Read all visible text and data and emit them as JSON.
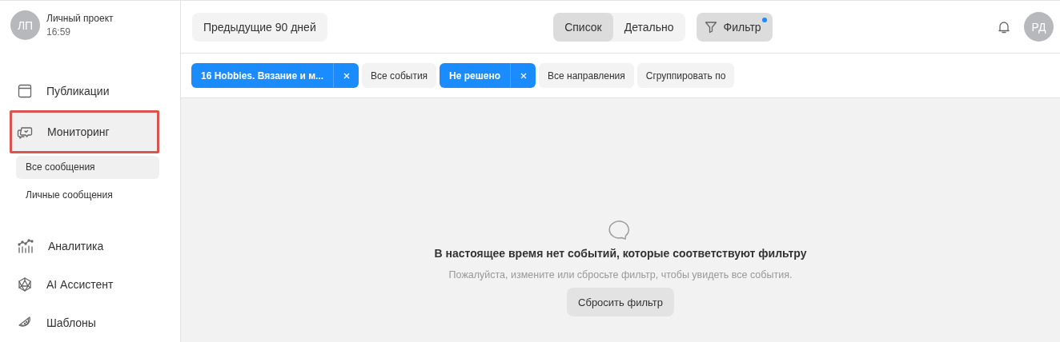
{
  "project": {
    "avatar": "ЛП",
    "name": "Личный проект",
    "time": "16:59"
  },
  "nav": [
    {
      "label": "Публикации",
      "selected": false,
      "outlined": false
    },
    {
      "label": "Мониторинг",
      "selected": true,
      "outlined": true,
      "children": [
        {
          "label": "Все сообщения",
          "selected": true
        },
        {
          "label": "Личные сообщения",
          "selected": false
        }
      ]
    },
    {
      "label": "Аналитика",
      "selected": false,
      "outlined": false
    },
    {
      "label": "AI Ассистент",
      "selected": false,
      "outlined": false
    },
    {
      "label": "Шаблоны",
      "selected": false,
      "outlined": false
    }
  ],
  "header": {
    "period": "Предыдущие 90 дней",
    "views": [
      {
        "label": "Список",
        "selected": true
      },
      {
        "label": "Детально",
        "selected": false
      }
    ],
    "filter": {
      "label": "Фильтр",
      "active": true
    },
    "user_avatar": "РД"
  },
  "chips": [
    {
      "kind": "active",
      "label": "16 Hobbies. Вязание и м..."
    },
    {
      "kind": "plain",
      "label": "Все события"
    },
    {
      "kind": "active",
      "label": "Не решено"
    },
    {
      "kind": "plain",
      "label": "Все направления"
    },
    {
      "kind": "plain",
      "label": "Сгруппировать по"
    }
  ],
  "empty": {
    "title": "В настоящее время нет событий, которые соответствуют фильтру",
    "message": "Пожалуйста, измените или сбросьте фильтр, чтобы увидеть все события.",
    "button": "Сбросить фильтр"
  }
}
